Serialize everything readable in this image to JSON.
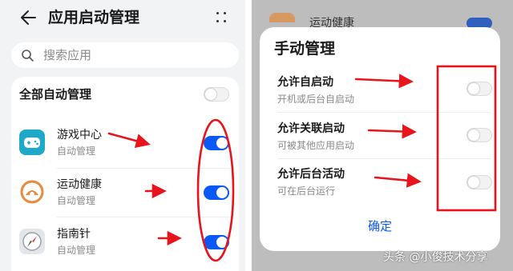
{
  "left": {
    "title": "应用启动管理",
    "search_placeholder": "搜索应用",
    "all_label": "全部自动管理",
    "apps": [
      {
        "name": "游戏中心",
        "sub": "自动管理"
      },
      {
        "name": "运动健康",
        "sub": "自动管理"
      },
      {
        "name": "指南针",
        "sub": "自动管理"
      }
    ]
  },
  "right": {
    "background_app": "运动健康",
    "dialog_title": "手动管理",
    "options": [
      {
        "title": "允许自启动",
        "sub": "开机或后台自启动"
      },
      {
        "title": "允许关联启动",
        "sub": "可被其他应用启动"
      },
      {
        "title": "允许后台活动",
        "sub": "可在后台运行"
      }
    ],
    "confirm_label": "确定"
  },
  "watermark": "头条 @小俊技术分享",
  "colors": {
    "accent": "#0a59f7",
    "annotation": "#e8141b"
  },
  "icons": [
    "back-arrow-icon",
    "more-dots-icon",
    "search-icon",
    "gamepad-icon",
    "health-icon",
    "compass-icon"
  ]
}
